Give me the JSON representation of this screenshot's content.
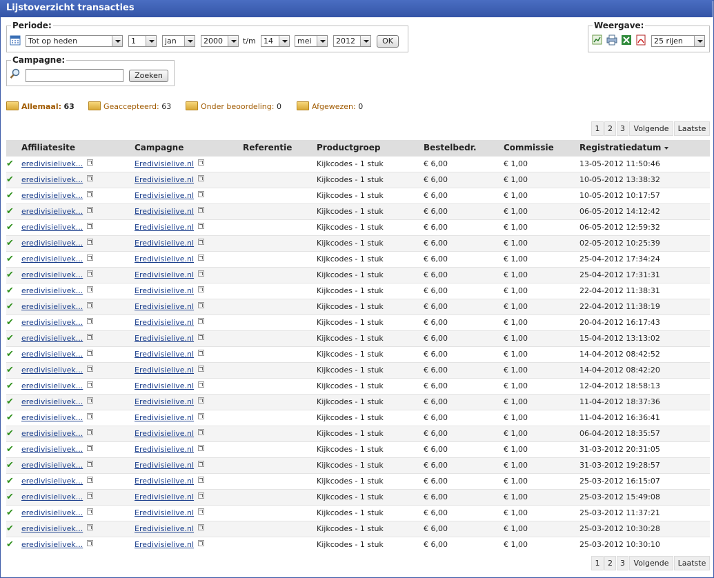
{
  "window": {
    "title": "Lijstoverzicht transacties"
  },
  "periode": {
    "legend": "Periode:",
    "preset": "Tot op heden",
    "from_day": "1",
    "from_month": "jan",
    "from_year": "2000",
    "separator": "t/m",
    "to_day": "14",
    "to_month": "mei",
    "to_year": "2012",
    "ok_label": "OK"
  },
  "campagne": {
    "legend": "Campagne:",
    "search_value": "",
    "search_label": "Zoeken"
  },
  "weergave": {
    "legend": "Weergave:",
    "rows_option": "25 rijen"
  },
  "status": {
    "all_label": "Allemaal:",
    "all_count": "63",
    "accepted_label": "Geaccepteerd:",
    "accepted_count": "63",
    "review_label": "Onder beoordeling:",
    "review_count": "0",
    "rejected_label": "Afgewezen:",
    "rejected_count": "0"
  },
  "pager": {
    "pages": [
      "1",
      "2",
      "3"
    ],
    "next_label": "Volgende",
    "last_label": "Laatste"
  },
  "table": {
    "columns": [
      "Affiliatesite",
      "Campagne",
      "Referentie",
      "Productgroep",
      "Bestelbedr.",
      "Commissie",
      "Registratiedatum"
    ],
    "rows": [
      {
        "affiliate": "eredivisielivek...",
        "campaign": "Eredivisielive.nl",
        "reference": "",
        "product": "Kijkcodes - 1 stuk",
        "amount": "€ 6,00",
        "commission": "€ 1,00",
        "date": "13-05-2012 11:50:46"
      },
      {
        "affiliate": "eredivisielivek...",
        "campaign": "Eredivisielive.nl",
        "reference": "",
        "product": "Kijkcodes - 1 stuk",
        "amount": "€ 6,00",
        "commission": "€ 1,00",
        "date": "10-05-2012 13:38:32"
      },
      {
        "affiliate": "eredivisielivek...",
        "campaign": "Eredivisielive.nl",
        "reference": "",
        "product": "Kijkcodes - 1 stuk",
        "amount": "€ 6,00",
        "commission": "€ 1,00",
        "date": "10-05-2012 10:17:57"
      },
      {
        "affiliate": "eredivisielivek...",
        "campaign": "Eredivisielive.nl",
        "reference": "",
        "product": "Kijkcodes - 1 stuk",
        "amount": "€ 6,00",
        "commission": "€ 1,00",
        "date": "06-05-2012 14:12:42"
      },
      {
        "affiliate": "eredivisielivek...",
        "campaign": "Eredivisielive.nl",
        "reference": "",
        "product": "Kijkcodes - 1 stuk",
        "amount": "€ 6,00",
        "commission": "€ 1,00",
        "date": "06-05-2012 12:59:32"
      },
      {
        "affiliate": "eredivisielivek...",
        "campaign": "Eredivisielive.nl",
        "reference": "",
        "product": "Kijkcodes - 1 stuk",
        "amount": "€ 6,00",
        "commission": "€ 1,00",
        "date": "02-05-2012 10:25:39"
      },
      {
        "affiliate": "eredivisielivek...",
        "campaign": "Eredivisielive.nl",
        "reference": "",
        "product": "Kijkcodes - 1 stuk",
        "amount": "€ 6,00",
        "commission": "€ 1,00",
        "date": "25-04-2012 17:34:24"
      },
      {
        "affiliate": "eredivisielivek...",
        "campaign": "Eredivisielive.nl",
        "reference": "",
        "product": "Kijkcodes - 1 stuk",
        "amount": "€ 6,00",
        "commission": "€ 1,00",
        "date": "25-04-2012 17:31:31"
      },
      {
        "affiliate": "eredivisielivek...",
        "campaign": "Eredivisielive.nl",
        "reference": "",
        "product": "Kijkcodes - 1 stuk",
        "amount": "€ 6,00",
        "commission": "€ 1,00",
        "date": "22-04-2012 11:38:31"
      },
      {
        "affiliate": "eredivisielivek...",
        "campaign": "Eredivisielive.nl",
        "reference": "",
        "product": "Kijkcodes - 1 stuk",
        "amount": "€ 6,00",
        "commission": "€ 1,00",
        "date": "22-04-2012 11:38:19"
      },
      {
        "affiliate": "eredivisielivek...",
        "campaign": "Eredivisielive.nl",
        "reference": "",
        "product": "Kijkcodes - 1 stuk",
        "amount": "€ 6,00",
        "commission": "€ 1,00",
        "date": "20-04-2012 16:17:43"
      },
      {
        "affiliate": "eredivisielivek...",
        "campaign": "Eredivisielive.nl",
        "reference": "",
        "product": "Kijkcodes - 1 stuk",
        "amount": "€ 6,00",
        "commission": "€ 1,00",
        "date": "15-04-2012 13:13:02"
      },
      {
        "affiliate": "eredivisielivek...",
        "campaign": "Eredivisielive.nl",
        "reference": "",
        "product": "Kijkcodes - 1 stuk",
        "amount": "€ 6,00",
        "commission": "€ 1,00",
        "date": "14-04-2012 08:42:52"
      },
      {
        "affiliate": "eredivisielivek...",
        "campaign": "Eredivisielive.nl",
        "reference": "",
        "product": "Kijkcodes - 1 stuk",
        "amount": "€ 6,00",
        "commission": "€ 1,00",
        "date": "14-04-2012 08:42:20"
      },
      {
        "affiliate": "eredivisielivek...",
        "campaign": "Eredivisielive.nl",
        "reference": "",
        "product": "Kijkcodes - 1 stuk",
        "amount": "€ 6,00",
        "commission": "€ 1,00",
        "date": "12-04-2012 18:58:13"
      },
      {
        "affiliate": "eredivisielivek...",
        "campaign": "Eredivisielive.nl",
        "reference": "",
        "product": "Kijkcodes - 1 stuk",
        "amount": "€ 6,00",
        "commission": "€ 1,00",
        "date": "11-04-2012 18:37:36"
      },
      {
        "affiliate": "eredivisielivek...",
        "campaign": "Eredivisielive.nl",
        "reference": "",
        "product": "Kijkcodes - 1 stuk",
        "amount": "€ 6,00",
        "commission": "€ 1,00",
        "date": "11-04-2012 16:36:41"
      },
      {
        "affiliate": "eredivisielivek...",
        "campaign": "Eredivisielive.nl",
        "reference": "",
        "product": "Kijkcodes - 1 stuk",
        "amount": "€ 6,00",
        "commission": "€ 1,00",
        "date": "06-04-2012 18:35:57"
      },
      {
        "affiliate": "eredivisielivek...",
        "campaign": "Eredivisielive.nl",
        "reference": "",
        "product": "Kijkcodes - 1 stuk",
        "amount": "€ 6,00",
        "commission": "€ 1,00",
        "date": "31-03-2012 20:31:05"
      },
      {
        "affiliate": "eredivisielivek...",
        "campaign": "Eredivisielive.nl",
        "reference": "",
        "product": "Kijkcodes - 1 stuk",
        "amount": "€ 6,00",
        "commission": "€ 1,00",
        "date": "31-03-2012 19:28:57"
      },
      {
        "affiliate": "eredivisielivek...",
        "campaign": "Eredivisielive.nl",
        "reference": "",
        "product": "Kijkcodes - 1 stuk",
        "amount": "€ 6,00",
        "commission": "€ 1,00",
        "date": "25-03-2012 16:15:07"
      },
      {
        "affiliate": "eredivisielivek...",
        "campaign": "Eredivisielive.nl",
        "reference": "",
        "product": "Kijkcodes - 1 stuk",
        "amount": "€ 6,00",
        "commission": "€ 1,00",
        "date": "25-03-2012 15:49:08"
      },
      {
        "affiliate": "eredivisielivek...",
        "campaign": "Eredivisielive.nl",
        "reference": "",
        "product": "Kijkcodes - 1 stuk",
        "amount": "€ 6,00",
        "commission": "€ 1,00",
        "date": "25-03-2012 11:37:21"
      },
      {
        "affiliate": "eredivisielivek...",
        "campaign": "Eredivisielive.nl",
        "reference": "",
        "product": "Kijkcodes - 1 stuk",
        "amount": "€ 6,00",
        "commission": "€ 1,00",
        "date": "25-03-2012 10:30:28"
      },
      {
        "affiliate": "eredivisielivek...",
        "campaign": "Eredivisielive.nl",
        "reference": "",
        "product": "Kijkcodes - 1 stuk",
        "amount": "€ 6,00",
        "commission": "€ 1,00",
        "date": "25-03-2012 10:30:10"
      }
    ]
  },
  "colors": {
    "titlebar": "#3b5aa8",
    "link": "#1a3e8c",
    "accepted": "#2d8f1a",
    "status_label": "#a05a00"
  },
  "icons": {
    "calendar": "calendar-icon",
    "search": "magnifier-icon",
    "accepted": "checkmark-icon",
    "external": "external-link-icon"
  }
}
